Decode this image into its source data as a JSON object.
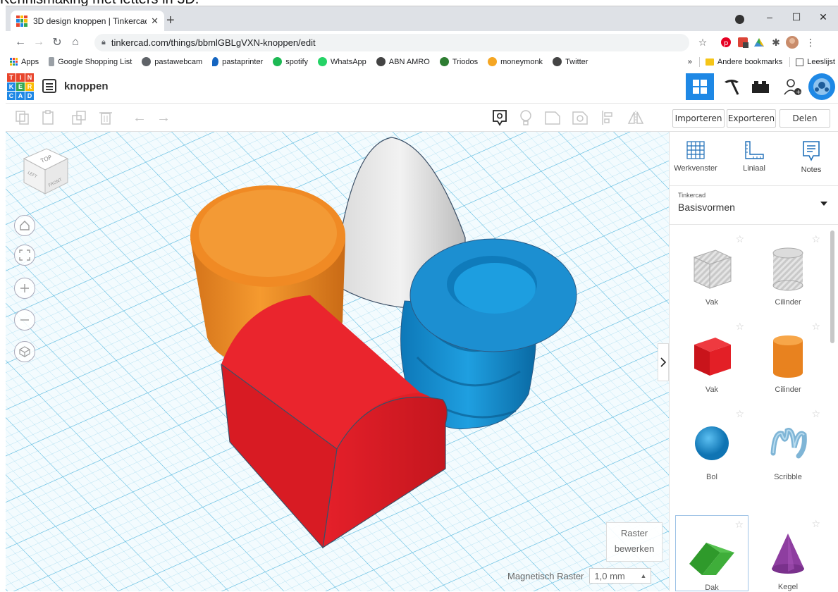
{
  "caption": "Kennismaking met letters in 3D.",
  "browser": {
    "tab_title": "3D design knoppen | Tinkercad",
    "tab_close": "✕",
    "new_tab": "+",
    "url": "tinkercad.com/things/bbmlGBLgVXN-knoppen/edit",
    "window_controls": [
      "–",
      "☐",
      "✕"
    ],
    "bookmarks": [
      {
        "label": "Apps",
        "color": "#1a73e8"
      },
      {
        "label": "Google Shopping List",
        "color": "#9aa0a6"
      },
      {
        "label": "pastawebcam",
        "color": "#5f6368"
      },
      {
        "label": "pastaprinter",
        "color": "#1565c0"
      },
      {
        "label": "spotify",
        "color": "#1db954"
      },
      {
        "label": "WhatsApp",
        "color": "#25d366"
      },
      {
        "label": "ABN AMRO",
        "color": "#444444"
      },
      {
        "label": "Triodos",
        "color": "#2e7d32"
      },
      {
        "label": "moneymonk",
        "color": "#f5a623"
      },
      {
        "label": "Twitter",
        "color": "#444444"
      }
    ],
    "bookmarks_overflow": "»",
    "other_bookmarks": "Andere bookmarks",
    "reading_list": "Leeslijst"
  },
  "app": {
    "logo_letters": [
      "T",
      "I",
      "N",
      "K",
      "E",
      "R",
      "C",
      "A",
      "D"
    ],
    "logo_colors": [
      "#e8452c",
      "#e8452c",
      "#e8452c",
      "#1e88e5",
      "#34a853",
      "#fbbc05",
      "#1e88e5",
      "#1e88e5",
      "#1e88e5"
    ],
    "doc_title": "knoppen",
    "accent": "#1e88e5"
  },
  "toolbar": {
    "icons": [
      "copy-icon",
      "paste-icon",
      "duplicate-icon",
      "delete-icon",
      "undo-icon",
      "redo-icon"
    ],
    "view_icons": [
      "show-notes-icon",
      "light-icon",
      "shape-icon",
      "hole-icon",
      "align-icon",
      "mirror-icon"
    ],
    "import": "Importeren",
    "export": "Exporteren",
    "share": "Delen"
  },
  "viewcube": {
    "top": "TOP",
    "front": "FRONT",
    "left": "LEFT"
  },
  "workplane": {
    "edit_grid_line1": "Raster",
    "edit_grid_line2": "bewerken",
    "snap_label": "Magnetisch Raster",
    "snap_value": "1,0 mm",
    "grid_color": "#6cc6e6"
  },
  "panel": {
    "tools": [
      {
        "label": "Werkvenster"
      },
      {
        "label": "Liniaal"
      },
      {
        "label": "Notes"
      }
    ],
    "library_owner": "Tinkercad",
    "library_name": "Basisvormen",
    "shapes": [
      {
        "label": "Vak",
        "color": "#b8b8b8"
      },
      {
        "label": "Cilinder",
        "color": "#b8b8b8"
      },
      {
        "label": "Vak",
        "color": "#e31f26"
      },
      {
        "label": "Cilinder",
        "color": "#f08a24"
      },
      {
        "label": "Bol",
        "color": "#1c8fd1"
      },
      {
        "label": "Scribble",
        "color": "#7fb5d6"
      },
      {
        "label": "Dak",
        "color": "#3fae3a"
      },
      {
        "label": "Kegel",
        "color": "#8e3ea0"
      }
    ]
  }
}
